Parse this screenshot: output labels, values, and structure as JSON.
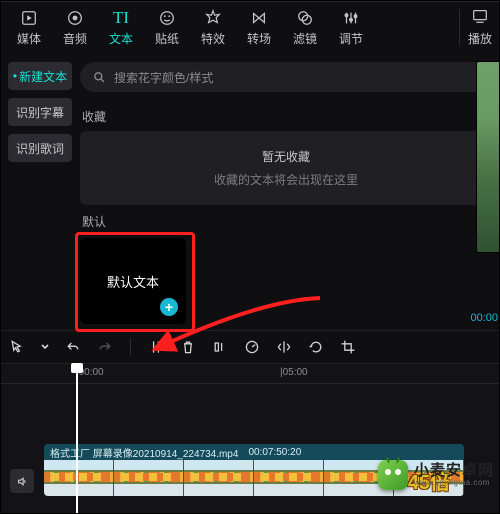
{
  "top_tabs": {
    "media": {
      "label": "媒体"
    },
    "audio": {
      "label": "音频"
    },
    "text": {
      "label": "文本"
    },
    "sticker": {
      "label": "贴纸"
    },
    "effect": {
      "label": "特效"
    },
    "trans": {
      "label": "转场"
    },
    "filter": {
      "label": "滤镜"
    },
    "adjust": {
      "label": "调节"
    },
    "player": {
      "label": "播放"
    }
  },
  "sidebar": {
    "items": [
      {
        "label": "新建文本"
      },
      {
        "label": "识别字幕"
      },
      {
        "label": "识别歌词"
      }
    ]
  },
  "search": {
    "placeholder": "搜索花字颜色/样式"
  },
  "sections": {
    "fav_label": "收藏",
    "fav_empty_title": "暂无收藏",
    "fav_empty_sub": "收藏的文本将会出现在这里",
    "default_label": "默认",
    "default_card_text": "默认文本"
  },
  "preview": {
    "time": "00:00"
  },
  "ruler": {
    "t0": "|00:00",
    "t1": "|05:00"
  },
  "clip": {
    "name": "格式工厂 屏幕录像20210914_224734.mp4",
    "dur": "00:07:50:20",
    "overlay_text": "45倍"
  },
  "watermark": {
    "cn": "小麦安卓网",
    "en": "www.xmsigma.com"
  }
}
